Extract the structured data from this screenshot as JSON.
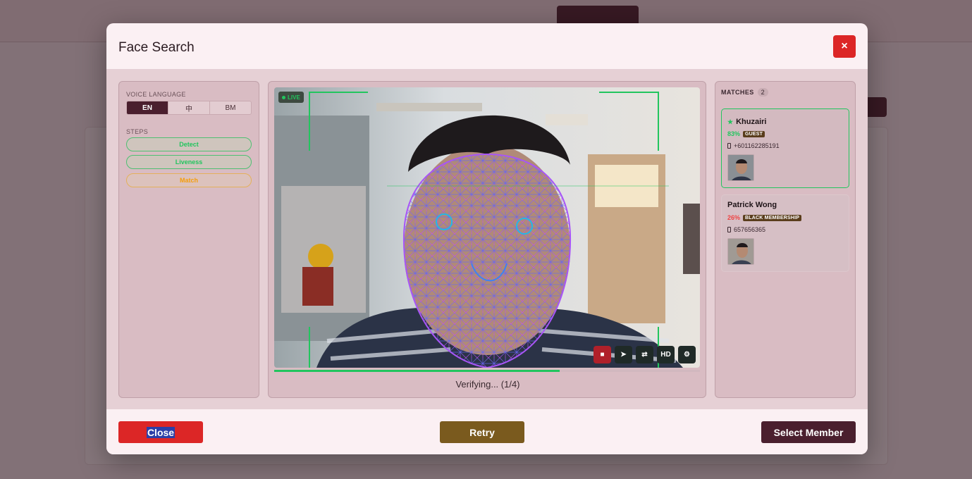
{
  "modal": {
    "title": "Face Search",
    "close_icon": "×"
  },
  "voice_language": {
    "label": "VOICE LANGUAGE",
    "options": [
      "EN",
      "中",
      "BM"
    ],
    "selected": "EN"
  },
  "steps": {
    "label": "STEPS",
    "items": [
      {
        "label": "Detect",
        "state": "done"
      },
      {
        "label": "Liveness",
        "state": "done"
      },
      {
        "label": "Match",
        "state": "pending"
      }
    ]
  },
  "video": {
    "live_label": "LIVE",
    "controls": {
      "stop": "■",
      "send": "➤",
      "camera_switch": "⇄",
      "hd": "HD",
      "settings": "⚙"
    },
    "progress_fraction": 0.67,
    "status_text": "Verifying... (1/4)"
  },
  "matches": {
    "title": "MATCHES",
    "count": "2",
    "items": [
      {
        "name": "Khuzairi",
        "score": "83%",
        "score_color": "#22c55e",
        "tag": "GUEST",
        "phone": "+601162285191",
        "best": true
      },
      {
        "name": "Patrick Wong",
        "score": "26%",
        "score_color": "#ef4444",
        "tag": "BLACK MEMBERSHIP",
        "phone": "657656365",
        "best": false
      }
    ]
  },
  "footer": {
    "close_label": "Close",
    "retry_label": "Retry",
    "select_label": "Select Member"
  },
  "colors": {
    "brand": "#4a1f2e",
    "danger": "#dc2626",
    "retry": "#7a5a1e",
    "success": "#22c55e"
  }
}
